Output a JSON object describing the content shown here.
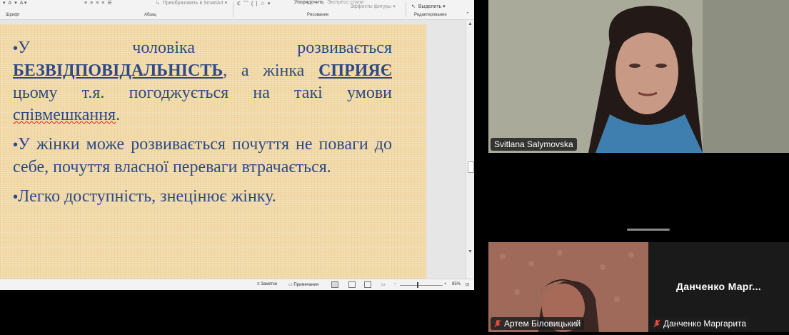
{
  "ribbon": {
    "groups": [
      "Шрифт",
      "Абзац",
      "Рисование",
      "Редактирование"
    ],
    "smartart_label": "Преобразовать в SmartArt",
    "arrange_label": "Упорядочить",
    "styles_label": "Экспресс-стили",
    "effects_label": "Эффекты фигуры",
    "select_label": "Выделить"
  },
  "slide": {
    "bullets": [
      {
        "prefix": "У чоловіка розвивається ",
        "emph1": "БЕЗВІДПОВІДАЛЬНІСТЬ",
        "mid1": ", а жінка ",
        "emph2": "СПРИЯЄ",
        "mid2": " цьому т.я. погоджується на такі умови ",
        "spell": "співмешкання",
        "suffix": "."
      },
      {
        "text": "У жінки може розвивається почуття не поваги до себе, почуття власної переваги втрачається."
      },
      {
        "text": "Легко доступність, знецінює жінку."
      }
    ],
    "bullet_char": "•"
  },
  "statusbar": {
    "notes_label": "Заметки",
    "comments_label": "Примечания",
    "zoom_label": "85%"
  },
  "participants": {
    "speaker": {
      "name": "Svitlana Salymovska"
    },
    "tile2": {
      "name": "Артем Біловицький"
    },
    "tile3": {
      "name": "Данченко Маргарита",
      "display_name": "Данченко  Марг..."
    }
  }
}
